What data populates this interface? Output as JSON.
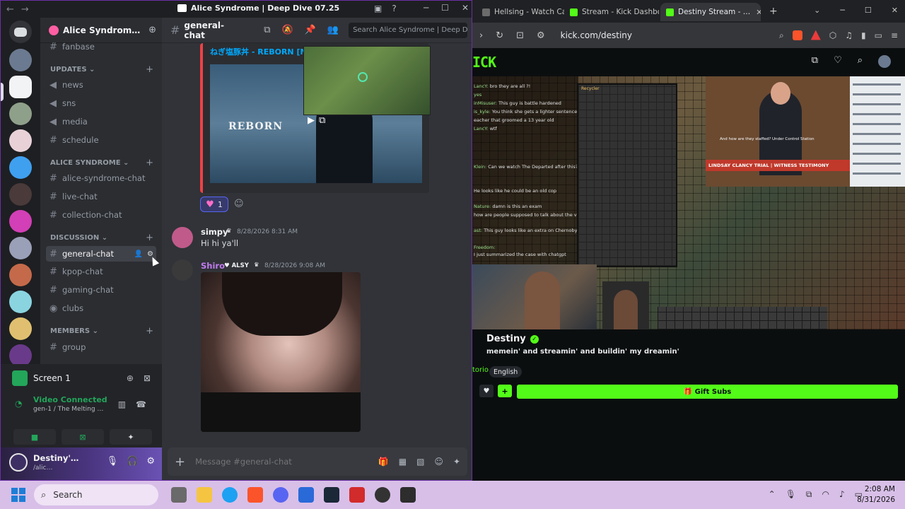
{
  "discord": {
    "window_title": "Alice Syndrome | Deep Dive 07.25",
    "nav": {
      "back": "←",
      "forward": "→"
    },
    "window_controls": {
      "minimize": "─",
      "maximize": "☐",
      "close": "✕"
    },
    "server": {
      "name": "Alice Syndrom…",
      "invite_icon": "person-add-icon"
    },
    "categories": [
      {
        "label": "UPDATES ⌄",
        "channels": [
          "news",
          "sns",
          "media",
          "schedule"
        ]
      },
      {
        "label": "ALICE SYNDROME ⌄",
        "channels": [
          "alice-syndrome-chat",
          "live-chat",
          "collection-chat"
        ]
      },
      {
        "label": "DISCUSSION ⌄",
        "channels": [
          "general-chat",
          "kpop-chat",
          "gaming-chat",
          "clubs"
        ]
      },
      {
        "label": "MEMBERS ⌄",
        "channels": [
          "group"
        ]
      }
    ],
    "top_partial_channel": "fanbase",
    "active_channel": "general-chat",
    "voice": {
      "screen_label": "Screen 1",
      "status": "Video Connected",
      "sub": "gen-1 / The Melting …"
    },
    "user": {
      "name": "Destiny'…",
      "sub": "/alic…"
    },
    "chat": {
      "channel": "general-chat",
      "search_placeholder": "Search Alice Syndrome | Deep D…",
      "embed_title": "ねぎ塩豚丼 - REBORN [M",
      "embed_thumb_text": "REBORN",
      "reaction": {
        "emoji": "♥",
        "count": "1"
      },
      "messages": [
        {
          "author": "simpy",
          "time": "8/28/2026 8:31 AM",
          "text": "Hi hi ya'll",
          "color": "#f2f3f5"
        },
        {
          "author": "Shiro",
          "badge": "♥ ALSY",
          "time": "8/28/2026 9:08 AM",
          "color": "#c27cf0"
        }
      ],
      "composer_placeholder": "Message #general-chat"
    }
  },
  "browser": {
    "tabs": [
      {
        "label": "Hellsing - Watch Carto…",
        "active": false,
        "color": "#6b6b6b"
      },
      {
        "label": "Stream - Kick Dashboa…",
        "active": false,
        "color": "#53fc18"
      },
      {
        "label": "Destiny Stream - …",
        "active": true,
        "color": "#53fc18"
      }
    ],
    "url": "kick.com/destiny",
    "kick_logo": "ICK",
    "stream": {
      "news_lower_third": "LINDSAY CLANCY TRIAL | WITNESS TESTIMONY",
      "news_caption": "And how are they staffed? Under Control Station",
      "inventory_title": "Recycler",
      "chat_lines": [
        {
          "user": "LancY:",
          "text": "bro they are all ?!"
        },
        {
          "user": "yes",
          "text": ""
        },
        {
          "user": "inMisuser:",
          "text": "This guy is battle hardened"
        },
        {
          "user": "is_kyle:",
          "text": "You think she gets a lighter sentence than a"
        },
        {
          "user": "",
          "text": "eacher that groomed a 13 year old"
        },
        {
          "user": "LancY:",
          "text": "wtf"
        },
        {
          "user": "Klein:",
          "text": "Can we watch The Departed after this?"
        },
        {
          "user": "",
          "text": "He looks like he could be an old cop"
        },
        {
          "user": "Nature:",
          "text": "damn is this an exam"
        },
        {
          "user": "",
          "text": "how are people supposed to talk about the vicitm"
        },
        {
          "user": "ast:",
          "text": "This guy looks like an extra on Chernobyl"
        },
        {
          "user": "Freedom:",
          "text": ""
        },
        {
          "user": "",
          "text": "I just summarized the case with chatgpt"
        }
      ]
    },
    "channel": {
      "streamer": "Destiny",
      "title": "memein' and streamin' and buildin' my dreamin'",
      "category": "torio",
      "language": "English",
      "gift_label": "Gift Subs"
    }
  },
  "taskbar": {
    "search_label": "Search",
    "time": "2:08 AM",
    "date": "8/31/2026"
  }
}
